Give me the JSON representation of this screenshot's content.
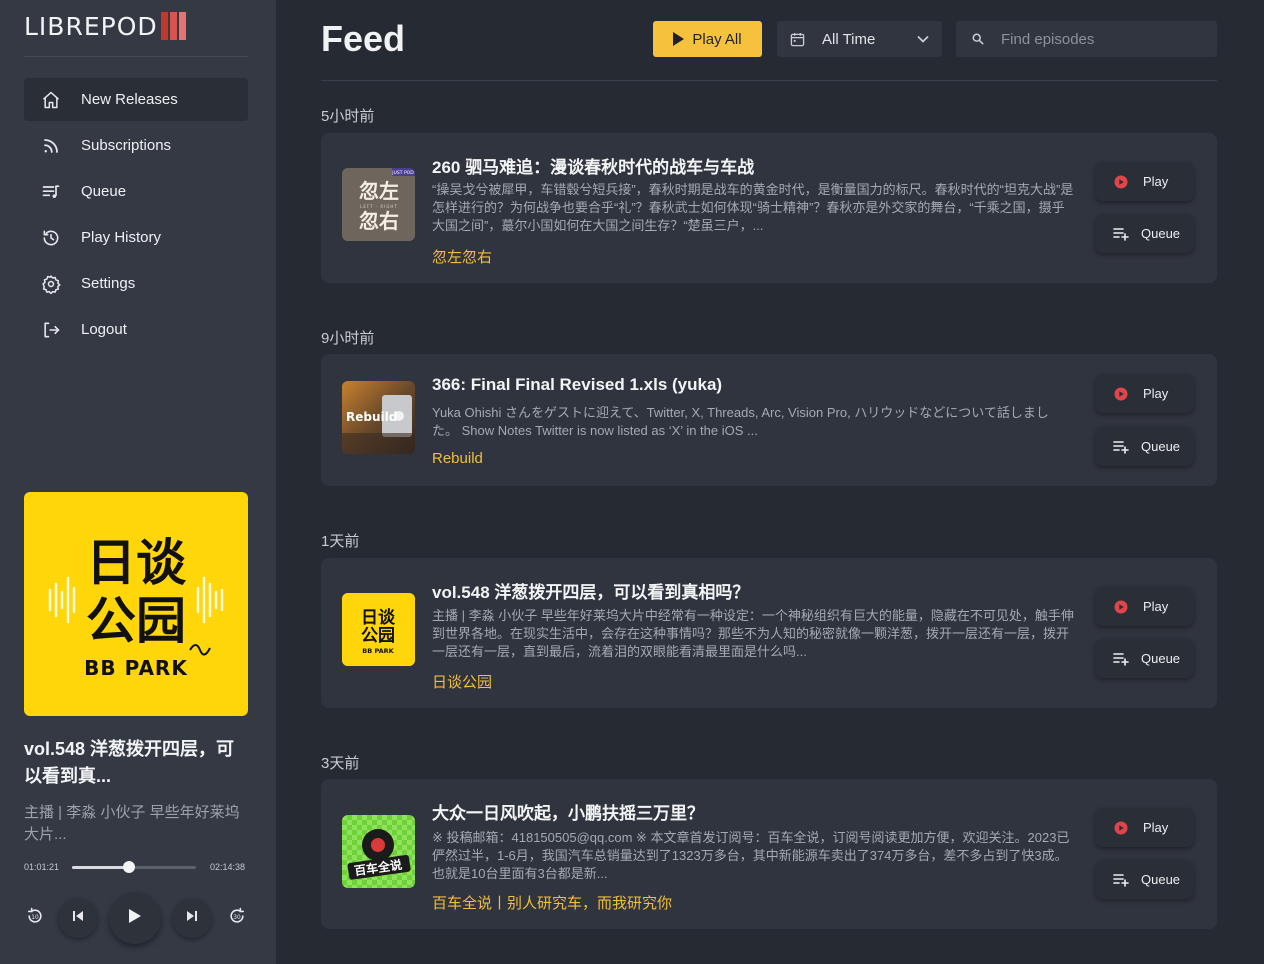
{
  "sidebar": {
    "logo_text": "LIBREPOD",
    "logo_bar_colors": [
      "#c0392b",
      "#d9534f",
      "#e57373"
    ],
    "nav": [
      {
        "label": "New Releases",
        "icon": "home-icon",
        "active": true
      },
      {
        "label": "Subscriptions",
        "icon": "rss-icon",
        "active": false
      },
      {
        "label": "Queue",
        "icon": "queue-list-icon",
        "active": false
      },
      {
        "label": "Play History",
        "icon": "history-icon",
        "active": false
      },
      {
        "label": "Settings",
        "icon": "gear-icon",
        "active": false
      },
      {
        "label": "Logout",
        "icon": "logout-icon",
        "active": false
      }
    ]
  },
  "now_playing": {
    "cover": {
      "line1": "日谈",
      "line2": "公园",
      "brand": "BB PARK",
      "bg": "#ffd60a"
    },
    "title": "vol.548 洋葱拨开四层，可以看到真...",
    "description": "主播 | 李淼 小伙子 早些年好莱坞大片...",
    "elapsed": "01:01:21",
    "duration": "02:14:38",
    "progress": 0.456,
    "controls": {
      "skip_back": "skip-back-10-icon",
      "prev": "previous-icon",
      "play": "play-icon",
      "next": "next-icon",
      "skip_forward": "skip-forward-icon"
    }
  },
  "header": {
    "title": "Feed",
    "play_all_label": "Play All",
    "time_filter": "All Time",
    "search_placeholder": "Find episodes"
  },
  "colors": {
    "accent": "#f6c23e",
    "podcast_link": "#f2bf3c",
    "play_dot": "#e0454c"
  },
  "groups": [
    {
      "label": "5小时前",
      "episodes": [
        {
          "title": "260 驷马难追：漫谈春秋时代的战车与车战",
          "description": "“操吴戈兮被犀甲，车错毂兮短兵接”，春秋时期是战车的黄金时代，是衡量国力的标尺。春秋时代的“坦克大战”是怎样进行的？为何战争也要合乎“礼”？春秋武士如何体现“骑士精神”？春秋亦是外交家的舞台，“千乘之国，摄乎大国之间”，蕞尔小国如何在大国之间生存？“楚虽三户，...",
          "podcast": "忽左忽右",
          "art": {
            "line1": "忽左",
            "line2": "忽右",
            "tag": "JUST POD",
            "sub": "LEFT · RIGHT"
          },
          "play_label": "Play",
          "queue_label": "Queue"
        }
      ]
    },
    {
      "label": "9小时前",
      "episodes": [
        {
          "title": "366: Final Final Revised 1.xls (yuka)",
          "description": "Yuka Ohishi さんをゲストに迎えて、Twitter, X, Threads, Arc, Vision Pro, ハリウッドなどについて話しました。 Show Notes Twitter is now listed as ‘X’ in the iOS ...",
          "podcast": "Rebuild",
          "art": {
            "text": "Rebuild"
          },
          "play_label": "Play",
          "queue_label": "Queue"
        }
      ]
    },
    {
      "label": "1天前",
      "episodes": [
        {
          "title": "vol.548 洋葱拨开四层，可以看到真相吗？",
          "description": "主播 | 李淼 小伙子 早些年好莱坞大片中经常有一种设定：一个神秘组织有巨大的能量，隐藏在不可见处，触手伸到世界各地。在现实生活中，会存在这种事情吗？那些不为人知的秘密就像一颗洋葱，拨开一层还有一层，拨开一层还有一层，直到最后，流着泪的双眼能看清最里面是什么吗...",
          "podcast": "日谈公园",
          "art": {
            "line1": "日谈",
            "line2": "公园",
            "brand": "BB PARK"
          },
          "play_label": "Play",
          "queue_label": "Queue"
        }
      ]
    },
    {
      "label": "3天前",
      "episodes": [
        {
          "title": "大众一日风吹起，小鹏扶摇三万里？",
          "description": "※ 投稿邮箱：418150505@qq.com ※ 本文章首发订阅号：百车全说，订阅号阅读更加方便，欢迎关注。2023已俨然过半，1-6月，我国汽车总销量达到了1323万多台，其中新能源车卖出了374万多台，差不多占到了快3成。也就是10台里面有3台都是新...",
          "podcast": "百车全说丨别人研究车，而我研究你",
          "art": {
            "text": "百车全说"
          },
          "play_label": "Play",
          "queue_label": "Queue"
        }
      ]
    }
  ]
}
